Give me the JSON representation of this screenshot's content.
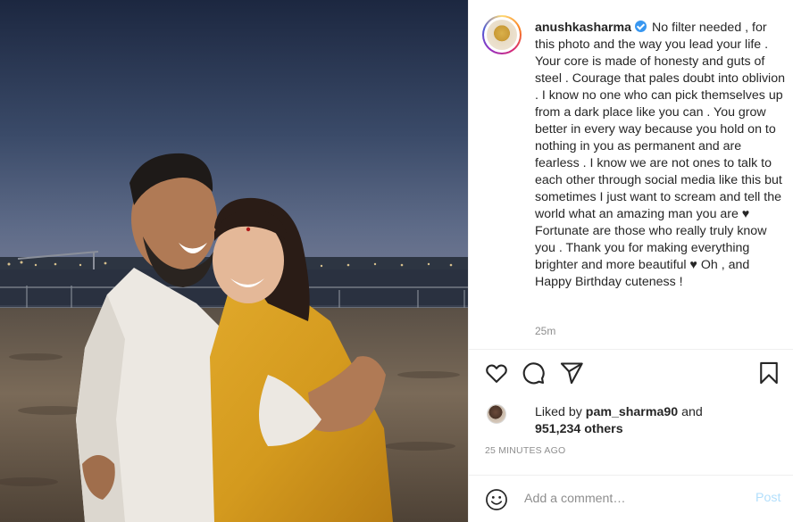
{
  "post": {
    "username": "anushkasharma",
    "caption": "No filter needed , for this photo and the way you lead your life . Your core is made of honesty and guts of steel . Courage that pales doubt into oblivion . I know no one who can pick themselves up from a dark place like you can . You grow better in every way because you hold on to nothing in you as permanent and are fearless . I know we are not ones to talk to each other through social media like this but sometimes I just want to scream and tell the world what an amazing man you are ♥ Fortunate are those who really truly know you . Thank you for making everything brighter and more beautiful ♥ Oh , and Happy Birthday cuteness !",
    "time_ago": "25m"
  },
  "likes": {
    "prefix": "Liked by",
    "liker": "pam_sharma90",
    "connector": "and",
    "count": "951,234 others"
  },
  "posted_label": "25 MINUTES AGO",
  "comment": {
    "placeholder": "Add a comment…",
    "post_label": "Post"
  },
  "colors": {
    "verified": "#3897f0",
    "post_button_disabled": "#b2dffc",
    "muted_text": "#8e8e8e"
  },
  "icons": [
    "heart-icon",
    "comment-icon",
    "share-icon",
    "bookmark-icon",
    "emoji-icon",
    "verified-badge-icon"
  ]
}
